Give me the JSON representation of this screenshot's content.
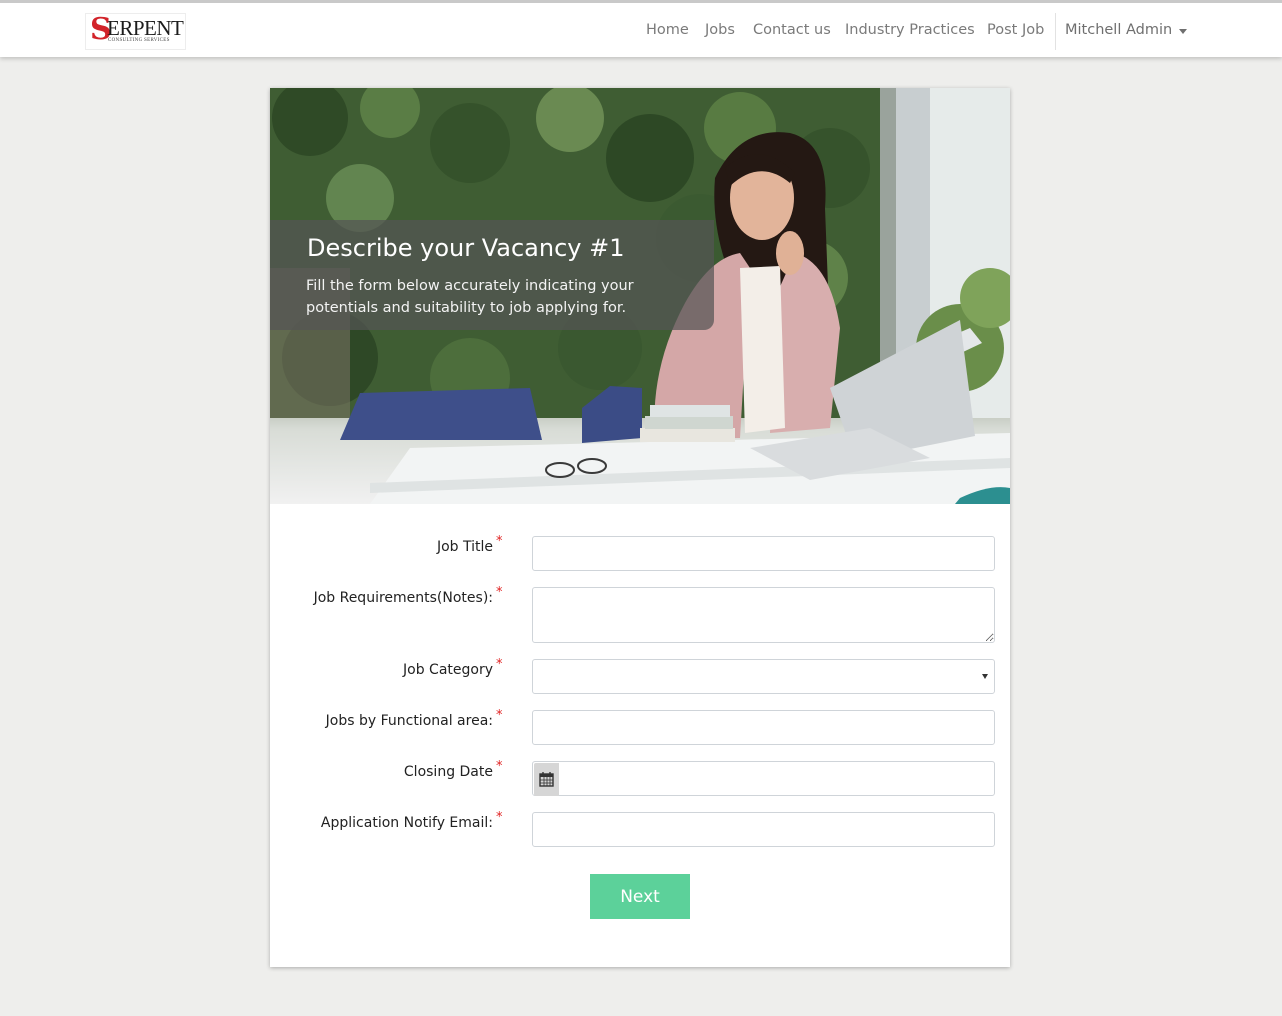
{
  "navbar": {
    "logo": {
      "initial": "S",
      "rest": "ERPENT",
      "tagline": "CONSULTING SERVICES"
    },
    "links": [
      {
        "id": "home",
        "label": "Home"
      },
      {
        "id": "jobs",
        "label": "Jobs"
      },
      {
        "id": "contact",
        "label": "Contact us"
      },
      {
        "id": "industry",
        "label": "Industry Practices"
      },
      {
        "id": "post",
        "label": "Post Job"
      }
    ],
    "user": "Mitchell Admin"
  },
  "hero": {
    "title": "Describe your Vacancy #1",
    "subtitle": "Fill the form below accurately indicating your potentials and suitability to job applying for."
  },
  "form": {
    "required_mark": "*",
    "fields": {
      "job_title": {
        "label": "Job Title",
        "value": ""
      },
      "job_requirements": {
        "label": "Job Requirements(Notes):",
        "value": ""
      },
      "job_category": {
        "label": "Job Category",
        "value": ""
      },
      "functional_area": {
        "label": "Jobs by Functional area:",
        "value": ""
      },
      "closing_date": {
        "label": "Closing Date",
        "value": ""
      },
      "notify_email": {
        "label": "Application Notify Email:",
        "value": ""
      }
    },
    "next_label": "Next"
  },
  "colors": {
    "accent_button": "#5cd19a",
    "required": "#e02020",
    "nav_text": "#7a7a7a"
  },
  "icons": [
    "calendar-icon",
    "chevron-down-icon",
    "select-caret-icon"
  ]
}
